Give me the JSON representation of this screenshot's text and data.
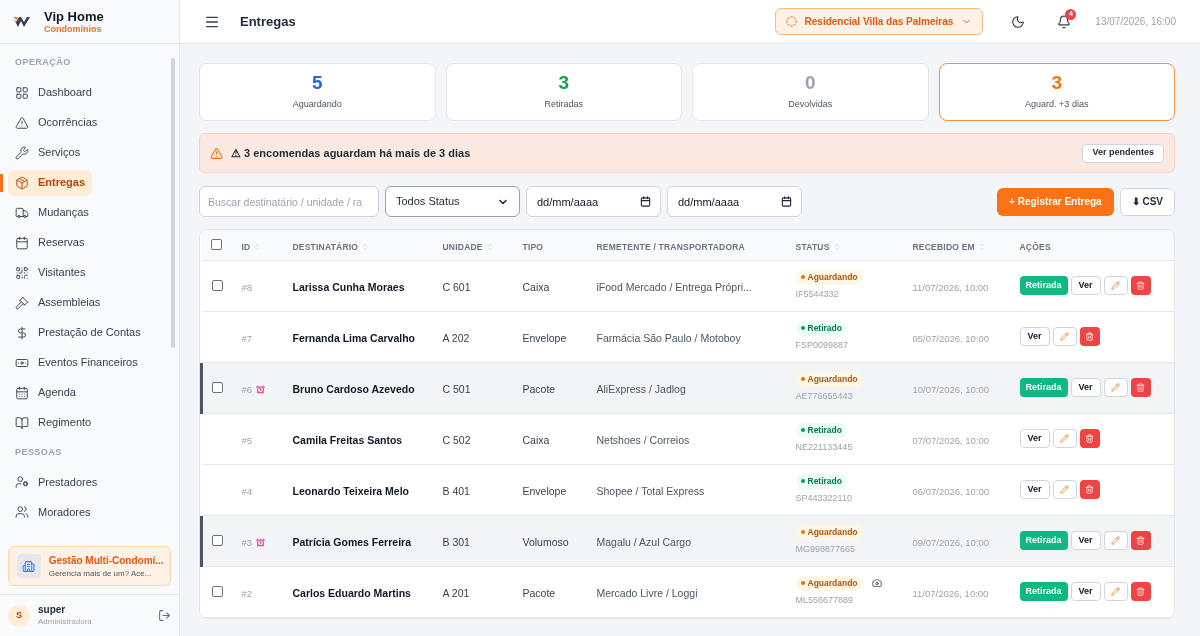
{
  "brand": {
    "name": "Vip Home",
    "subtitle": "Condomínios"
  },
  "sidebar": {
    "sections": [
      {
        "title": "OPERAÇÃO",
        "items": [
          {
            "label": "Dashboard",
            "selected": false
          },
          {
            "label": "Ocorrências",
            "selected": false
          },
          {
            "label": "Serviços",
            "selected": false
          },
          {
            "label": "Entregas",
            "selected": true
          },
          {
            "label": "Mudanças",
            "selected": false
          },
          {
            "label": "Reservas",
            "selected": false
          },
          {
            "label": "Visitantes",
            "selected": false
          },
          {
            "label": "Assembleias",
            "selected": false
          },
          {
            "label": "Prestação de Contas",
            "selected": false
          },
          {
            "label": "Eventos Financeiros",
            "selected": false
          },
          {
            "label": "Agenda",
            "selected": false
          },
          {
            "label": "Regimento",
            "selected": false
          }
        ]
      },
      {
        "title": "PESSOAS",
        "items": [
          {
            "label": "Prestadores",
            "selected": false
          },
          {
            "label": "Moradores",
            "selected": false
          }
        ]
      }
    ],
    "promo": {
      "title": "Gestão Multi-Condomí...",
      "text": "Gerencia mais de um? Ace..."
    },
    "user": {
      "initial": "S",
      "name": "super",
      "role": "Administradora"
    }
  },
  "header": {
    "title": "Entregas",
    "condo": "Residencial Villa das Palmeiras",
    "notifications": "4",
    "datetime": "13/07/2026, 16:00"
  },
  "stats": [
    {
      "value": "5",
      "label": "Aguardando",
      "color": "#2563eb",
      "selected": false
    },
    {
      "value": "3",
      "label": "Retiradas",
      "color": "#16a34a",
      "selected": false
    },
    {
      "value": "0",
      "label": "Devolvidas",
      "color": "#9ca3af",
      "selected": false
    },
    {
      "value": "3",
      "label": "Aguard. +3 dias",
      "color": "#f97316",
      "selected": true
    }
  ],
  "alert": {
    "text": "⚠ 3 encomendas aguardam há mais de 3 dias",
    "button": "Ver pendentes"
  },
  "filters": {
    "search_placeholder": "Buscar destinatário / unidade / ra",
    "status": "Todos Status",
    "date_from_placeholder": "dd/mm/aaaa",
    "date_to_placeholder": "dd/mm/aaaa",
    "register_button": "+ Registrar Entrega",
    "csv_button": "⬇ CSV"
  },
  "table": {
    "all_checked": false,
    "columns": [
      {
        "label": "ID",
        "sortable": true
      },
      {
        "label": "DESTINATÁRIO",
        "sortable": true
      },
      {
        "label": "UNIDADE",
        "sortable": true
      },
      {
        "label": "TIPO",
        "sortable": false
      },
      {
        "label": "REMETENTE / TRANSPORTADORA",
        "sortable": false
      },
      {
        "label": "STATUS",
        "sortable": true
      },
      {
        "label": "RECEBIDO EM",
        "sortable": true
      },
      {
        "label": "AÇÕES",
        "sortable": false
      }
    ],
    "rows": [
      {
        "id": "#8",
        "overdue": false,
        "checked": false,
        "recipient": "Larissa Cunha Moraes",
        "unit": "C 601",
        "type": "Caixa",
        "sender": "iFood Mercado / Entrega Própri...",
        "status": {
          "kind": "waiting",
          "label": "Aguardando"
        },
        "code": "IF5544332",
        "photo": false,
        "received": "11/07/2026, 10:00",
        "actions": [
          "Retirada",
          "Ver"
        ]
      },
      {
        "id": "#7",
        "overdue": false,
        "recipient": "Fernanda Lima Carvalho",
        "unit": "A 202",
        "type": "Envelope",
        "sender": "Farmácia São Paulo / Motoboy",
        "status": {
          "kind": "picked",
          "label": "Retirado"
        },
        "code": "FSP0099887",
        "photo": false,
        "received": "05/07/2026, 10:00",
        "actions": [
          "Ver"
        ]
      },
      {
        "id": "#6",
        "overdue": true,
        "checked": false,
        "recipient": "Bruno Cardoso Azevedo",
        "unit": "C 501",
        "type": "Pacote",
        "sender": "AliExpress / Jadlog",
        "status": {
          "kind": "waiting",
          "label": "Aguardando"
        },
        "code": "AE776655443",
        "photo": false,
        "received": "10/07/2026, 10:00",
        "actions": [
          "Retirada",
          "Ver"
        ]
      },
      {
        "id": "#5",
        "overdue": false,
        "recipient": "Camila Freitas Santos",
        "unit": "C 502",
        "type": "Caixa",
        "sender": "Netshoes / Correios",
        "status": {
          "kind": "picked",
          "label": "Retirado"
        },
        "code": "NE221133445",
        "photo": false,
        "received": "07/07/2026, 10:00",
        "actions": [
          "Ver"
        ]
      },
      {
        "id": "#4",
        "overdue": false,
        "recipient": "Leonardo Teixeira Melo",
        "unit": "B 401",
        "type": "Envelope",
        "sender": "Shopee / Total Express",
        "status": {
          "kind": "picked",
          "label": "Retirado"
        },
        "code": "SP443322110",
        "photo": false,
        "received": "06/07/2026, 10:00",
        "actions": [
          "Ver"
        ]
      },
      {
        "id": "#3",
        "overdue": true,
        "checked": false,
        "recipient": "Patrícia Gomes Ferreira",
        "unit": "B 301",
        "type": "Volumoso",
        "sender": "Magalu / Azul Cargo",
        "status": {
          "kind": "waiting",
          "label": "Aguardando"
        },
        "code": "MG998877665",
        "photo": false,
        "received": "09/07/2026, 10:00",
        "actions": [
          "Retirada",
          "Ver"
        ]
      },
      {
        "id": "#2",
        "overdue": false,
        "checked": false,
        "recipient": "Carlos Eduardo Martins",
        "unit": "A 201",
        "type": "Pacote",
        "sender": "Mercado Livre / Loggi",
        "status": {
          "kind": "waiting",
          "label": "Aguardando"
        },
        "code": "ML556677889",
        "photo": true,
        "received": "11/07/2026, 10:00",
        "actions": [
          "Retirada",
          "Ver"
        ]
      }
    ]
  }
}
